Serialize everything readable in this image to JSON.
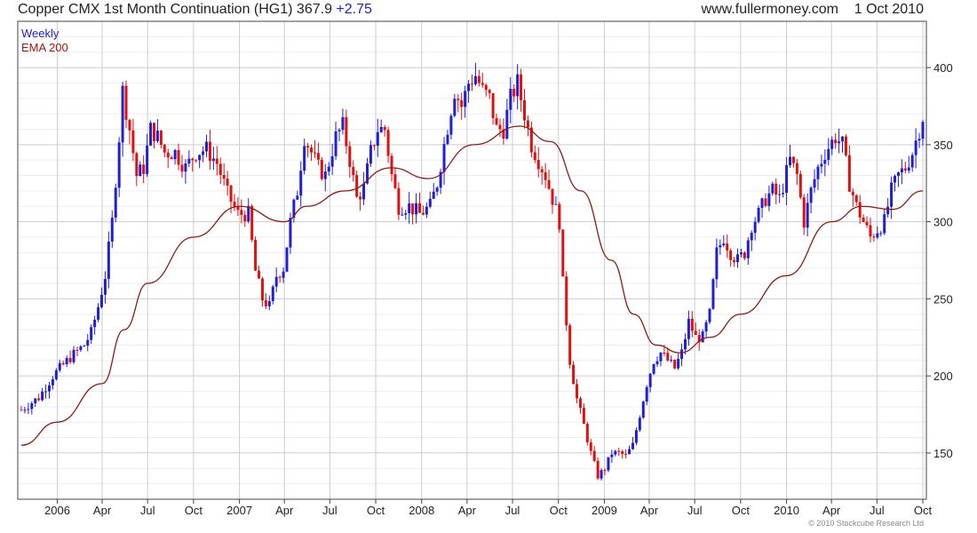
{
  "header": {
    "title": "Copper CMX 1st Month Continuation (HG1)",
    "last": "367.9",
    "change": "+2.75",
    "source": "www.fullermoney.com",
    "date": "1 Oct 2010"
  },
  "legend": {
    "series1": "Weekly",
    "series2": "EMA 200"
  },
  "copyright": "© 2010 Stockcube Research Ltd",
  "colors": {
    "up": "#1f1fd8",
    "down": "#e01010",
    "ema": "#8b1a1a",
    "grid": "#cccccc",
    "frame": "#444444"
  },
  "chart_data": {
    "type": "candlestick",
    "y_axis": {
      "min": 120,
      "max": 430,
      "ticks": [
        150,
        200,
        250,
        300,
        350,
        400
      ],
      "position": "right"
    },
    "x_axis": {
      "start": "2005-10-21",
      "end": "2010-10-01"
    },
    "x_ticks": [
      {
        "date": "2006-01-01",
        "label": "2006"
      },
      {
        "date": "2006-04-01",
        "label": "Apr"
      },
      {
        "date": "2006-07-01",
        "label": "Jul"
      },
      {
        "date": "2006-10-01",
        "label": "Oct"
      },
      {
        "date": "2007-01-01",
        "label": "2007"
      },
      {
        "date": "2007-04-01",
        "label": "Apr"
      },
      {
        "date": "2007-07-01",
        "label": "Jul"
      },
      {
        "date": "2007-10-01",
        "label": "Oct"
      },
      {
        "date": "2008-01-01",
        "label": "2008"
      },
      {
        "date": "2008-04-01",
        "label": "Apr"
      },
      {
        "date": "2008-07-01",
        "label": "Jul"
      },
      {
        "date": "2008-10-01",
        "label": "Oct"
      },
      {
        "date": "2009-01-01",
        "label": "2009"
      },
      {
        "date": "2009-04-01",
        "label": "Apr"
      },
      {
        "date": "2009-07-01",
        "label": "Jul"
      },
      {
        "date": "2009-10-01",
        "label": "Oct"
      },
      {
        "date": "2010-01-01",
        "label": "2010"
      },
      {
        "date": "2010-04-01",
        "label": "Apr"
      },
      {
        "date": "2010-07-01",
        "label": "Jul"
      },
      {
        "date": "2010-10-01",
        "label": "Oct"
      }
    ],
    "close_path": [
      [
        "2005-10-21",
        178
      ],
      [
        "2005-11-25",
        186
      ],
      [
        "2005-12-23",
        200
      ],
      [
        "2006-01-27",
        212
      ],
      [
        "2006-02-24",
        220
      ],
      [
        "2006-03-10",
        228
      ],
      [
        "2006-03-24",
        245
      ],
      [
        "2006-04-07",
        265
      ],
      [
        "2006-04-21",
        300
      ],
      [
        "2006-05-05",
        355
      ],
      [
        "2006-05-12",
        385
      ],
      [
        "2006-05-26",
        360
      ],
      [
        "2006-06-09",
        330
      ],
      [
        "2006-06-23",
        335
      ],
      [
        "2006-07-07",
        360
      ],
      [
        "2006-07-21",
        355
      ],
      [
        "2006-08-04",
        345
      ],
      [
        "2006-08-25",
        345
      ],
      [
        "2006-09-15",
        335
      ],
      [
        "2006-10-06",
        345
      ],
      [
        "2006-10-27",
        347
      ],
      [
        "2006-11-17",
        338
      ],
      [
        "2006-12-08",
        318
      ],
      [
        "2006-12-29",
        305
      ],
      [
        "2007-01-19",
        305
      ],
      [
        "2007-02-02",
        268
      ],
      [
        "2007-02-16",
        250
      ],
      [
        "2007-03-02",
        245
      ],
      [
        "2007-03-16",
        265
      ],
      [
        "2007-03-30",
        270
      ],
      [
        "2007-04-13",
        300
      ],
      [
        "2007-04-27",
        320
      ],
      [
        "2007-05-11",
        355
      ],
      [
        "2007-05-25",
        345
      ],
      [
        "2007-06-08",
        335
      ],
      [
        "2007-06-22",
        330
      ],
      [
        "2007-07-13",
        355
      ],
      [
        "2007-07-27",
        362
      ],
      [
        "2007-08-10",
        340
      ],
      [
        "2007-08-24",
        315
      ],
      [
        "2007-09-07",
        322
      ],
      [
        "2007-09-21",
        345
      ],
      [
        "2007-10-05",
        360
      ],
      [
        "2007-10-19",
        360
      ],
      [
        "2007-11-02",
        330
      ],
      [
        "2007-11-16",
        310
      ],
      [
        "2007-12-07",
        310
      ],
      [
        "2007-12-28",
        305
      ],
      [
        "2008-01-18",
        310
      ],
      [
        "2008-02-01",
        325
      ],
      [
        "2008-02-15",
        350
      ],
      [
        "2008-03-07",
        385
      ],
      [
        "2008-03-21",
        375
      ],
      [
        "2008-04-04",
        390
      ],
      [
        "2008-04-18",
        395
      ],
      [
        "2008-05-02",
        385
      ],
      [
        "2008-05-16",
        380
      ],
      [
        "2008-05-30",
        360
      ],
      [
        "2008-06-13",
        360
      ],
      [
        "2008-06-27",
        380
      ],
      [
        "2008-07-11",
        390
      ],
      [
        "2008-07-25",
        370
      ],
      [
        "2008-08-08",
        350
      ],
      [
        "2008-08-22",
        340
      ],
      [
        "2008-09-05",
        330
      ],
      [
        "2008-09-19",
        315
      ],
      [
        "2008-10-03",
        300
      ],
      [
        "2008-10-10",
        260
      ],
      [
        "2008-10-24",
        210
      ],
      [
        "2008-11-07",
        185
      ],
      [
        "2008-11-21",
        168
      ],
      [
        "2008-12-05",
        150
      ],
      [
        "2008-12-19",
        135
      ],
      [
        "2009-01-02",
        140
      ],
      [
        "2009-01-16",
        150
      ],
      [
        "2009-01-30",
        150
      ],
      [
        "2009-02-13",
        148
      ],
      [
        "2009-02-27",
        155
      ],
      [
        "2009-03-13",
        175
      ],
      [
        "2009-03-27",
        195
      ],
      [
        "2009-04-10",
        210
      ],
      [
        "2009-04-24",
        215
      ],
      [
        "2009-05-08",
        210
      ],
      [
        "2009-05-22",
        205
      ],
      [
        "2009-06-05",
        215
      ],
      [
        "2009-06-19",
        235
      ],
      [
        "2009-07-03",
        225
      ],
      [
        "2009-07-17",
        225
      ],
      [
        "2009-07-31",
        240
      ],
      [
        "2009-08-14",
        280
      ],
      [
        "2009-08-28",
        290
      ],
      [
        "2009-09-11",
        280
      ],
      [
        "2009-09-25",
        275
      ],
      [
        "2009-10-09",
        280
      ],
      [
        "2009-10-23",
        298
      ],
      [
        "2009-11-06",
        305
      ],
      [
        "2009-11-20",
        315
      ],
      [
        "2009-12-04",
        320
      ],
      [
        "2009-12-18",
        315
      ],
      [
        "2010-01-08",
        340
      ],
      [
        "2010-01-22",
        330
      ],
      [
        "2010-02-05",
        300
      ],
      [
        "2010-02-19",
        320
      ],
      [
        "2010-03-05",
        335
      ],
      [
        "2010-03-19",
        345
      ],
      [
        "2010-04-09",
        355
      ],
      [
        "2010-04-23",
        350
      ],
      [
        "2010-05-07",
        325
      ],
      [
        "2010-05-21",
        310
      ],
      [
        "2010-06-04",
        300
      ],
      [
        "2010-06-18",
        290
      ],
      [
        "2010-07-02",
        295
      ],
      [
        "2010-07-16",
        300
      ],
      [
        "2010-07-30",
        320
      ],
      [
        "2010-08-13",
        330
      ],
      [
        "2010-08-27",
        335
      ],
      [
        "2010-09-10",
        345
      ],
      [
        "2010-09-24",
        360
      ],
      [
        "2010-10-01",
        368
      ]
    ],
    "ema_200": [
      [
        "2005-10-21",
        155
      ],
      [
        "2006-01-01",
        170
      ],
      [
        "2006-04-01",
        195
      ],
      [
        "2006-05-15",
        230
      ],
      [
        "2006-07-01",
        260
      ],
      [
        "2006-10-01",
        290
      ],
      [
        "2007-01-01",
        310
      ],
      [
        "2007-04-01",
        300
      ],
      [
        "2007-05-15",
        310
      ],
      [
        "2007-08-01",
        320
      ],
      [
        "2007-11-01",
        335
      ],
      [
        "2008-01-15",
        328
      ],
      [
        "2008-04-15",
        350
      ],
      [
        "2008-07-15",
        362
      ],
      [
        "2008-09-15",
        352
      ],
      [
        "2008-11-15",
        320
      ],
      [
        "2009-01-15",
        275
      ],
      [
        "2009-03-01",
        240
      ],
      [
        "2009-04-15",
        220
      ],
      [
        "2009-06-01",
        215
      ],
      [
        "2009-08-01",
        225
      ],
      [
        "2009-10-01",
        240
      ],
      [
        "2010-01-01",
        265
      ],
      [
        "2010-04-01",
        300
      ],
      [
        "2010-06-01",
        310
      ],
      [
        "2010-08-01",
        308
      ],
      [
        "2010-10-01",
        320
      ]
    ]
  }
}
